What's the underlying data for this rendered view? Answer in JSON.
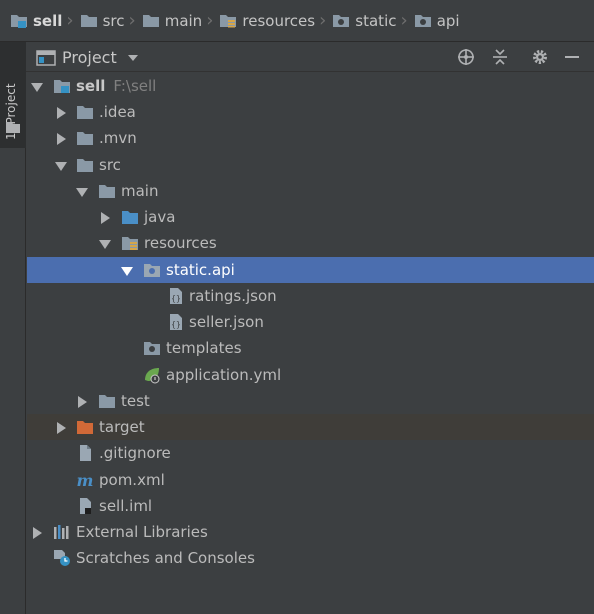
{
  "breadcrumb": {
    "items": [
      {
        "label": "sell",
        "icon": "module-folder-icon",
        "bold": true
      },
      {
        "label": "src",
        "icon": "folder-icon"
      },
      {
        "label": "main",
        "icon": "folder-icon"
      },
      {
        "label": "resources",
        "icon": "resources-folder-icon"
      },
      {
        "label": "static",
        "icon": "folder-icon"
      },
      {
        "label": "api",
        "icon": "folder-icon"
      }
    ]
  },
  "side_stripe": {
    "label": "1: Project",
    "icon": "folder-icon"
  },
  "tool_window": {
    "title": "Project",
    "actions": [
      "locate-icon",
      "collapse-all-icon",
      "settings-gear-icon",
      "minimize-icon"
    ]
  },
  "tree": {
    "items": [
      {
        "label": "sell",
        "extra": "F:\\sell",
        "icon": "module-folder-icon",
        "arrow": "expanded",
        "bold": true
      },
      {
        "label": ".idea",
        "icon": "folder-icon",
        "arrow": "collapsed"
      },
      {
        "label": ".mvn",
        "icon": "folder-icon",
        "arrow": "collapsed"
      },
      {
        "label": "src",
        "icon": "folder-icon",
        "arrow": "expanded"
      },
      {
        "label": "main",
        "icon": "folder-icon",
        "arrow": "expanded"
      },
      {
        "label": "java",
        "icon": "source-folder-icon",
        "arrow": "collapsed"
      },
      {
        "label": "resources",
        "icon": "resources-folder-icon",
        "arrow": "expanded"
      },
      {
        "label": "static.api",
        "icon": "web-folder-icon",
        "arrow": "expanded",
        "selected": true
      },
      {
        "label": "ratings.json",
        "icon": "json-file-icon"
      },
      {
        "label": "seller.json",
        "icon": "json-file-icon"
      },
      {
        "label": "templates",
        "icon": "web-folder-icon"
      },
      {
        "label": "application.yml",
        "icon": "spring-config-icon"
      },
      {
        "label": "test",
        "icon": "folder-icon",
        "arrow": "collapsed"
      },
      {
        "label": "target",
        "icon": "excluded-folder-icon",
        "arrow": "collapsed",
        "excluded": true
      },
      {
        "label": ".gitignore",
        "icon": "text-file-icon"
      },
      {
        "label": "pom.xml",
        "icon": "maven-file-icon"
      },
      {
        "label": "sell.iml",
        "icon": "iml-file-icon"
      },
      {
        "label": "External Libraries",
        "icon": "libraries-icon",
        "arrow": "collapsed"
      },
      {
        "label": "Scratches and Consoles",
        "icon": "scratches-icon"
      }
    ]
  },
  "colors": {
    "background": "#3c3f41",
    "selection": "#4b6eaf",
    "excluded_folder": "#d26937",
    "source_folder": "#4a8fc7",
    "folder": "#8a99a6"
  }
}
